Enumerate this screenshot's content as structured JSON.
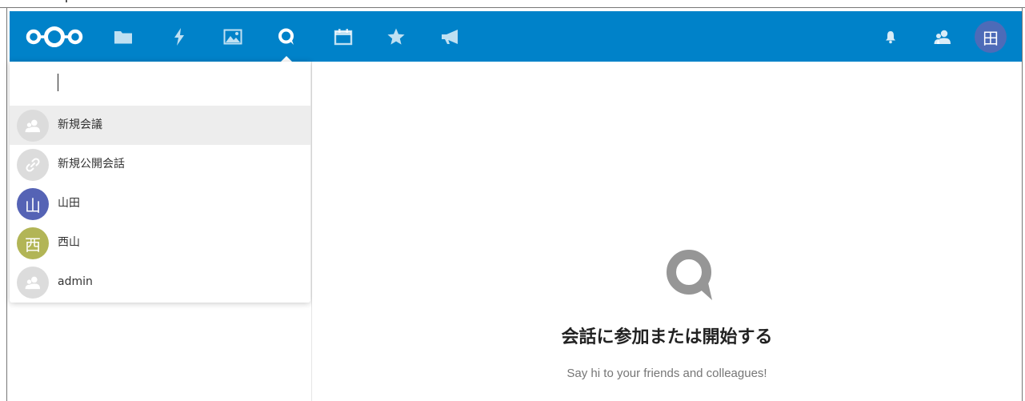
{
  "header": {
    "background_color": "#0082c9",
    "logo_icon": "nextcloud-logo-icon",
    "apps": [
      {
        "name": "files",
        "icon": "folder-icon"
      },
      {
        "name": "activity",
        "icon": "lightning-icon"
      },
      {
        "name": "gallery",
        "icon": "image-icon"
      },
      {
        "name": "talk",
        "icon": "talk-icon",
        "active": true
      },
      {
        "name": "calendar",
        "icon": "calendar-icon"
      },
      {
        "name": "favorites",
        "icon": "star-icon"
      },
      {
        "name": "announcements",
        "icon": "megaphone-icon"
      }
    ],
    "notifications_icon": "bell-icon",
    "contacts_icon": "contacts-icon",
    "user_avatar_letter": "田",
    "user_avatar_color": "#4d6bb8"
  },
  "search": {
    "value": "",
    "placeholder": ""
  },
  "results": [
    {
      "label": "新規会議",
      "avatar_icon": "user-group-icon",
      "avatar_color": "#dcdcdc",
      "selected": true
    },
    {
      "label": "新規公開会話",
      "avatar_icon": "link-icon",
      "avatar_color": "#dcdcdc",
      "selected": false
    },
    {
      "label": "山田",
      "avatar_letter": "山",
      "avatar_color": "#5563b5",
      "selected": false
    },
    {
      "label": "西山",
      "avatar_letter": "西",
      "avatar_color": "#b2b556",
      "selected": false
    },
    {
      "label": "admin",
      "avatar_icon": "user-group-icon",
      "avatar_color": "#dcdcdc",
      "selected": false
    }
  ],
  "empty_state": {
    "icon": "talk-icon",
    "title": "会話に参加または開始する",
    "subtitle": "Say hi to your friends and colleagues!"
  }
}
